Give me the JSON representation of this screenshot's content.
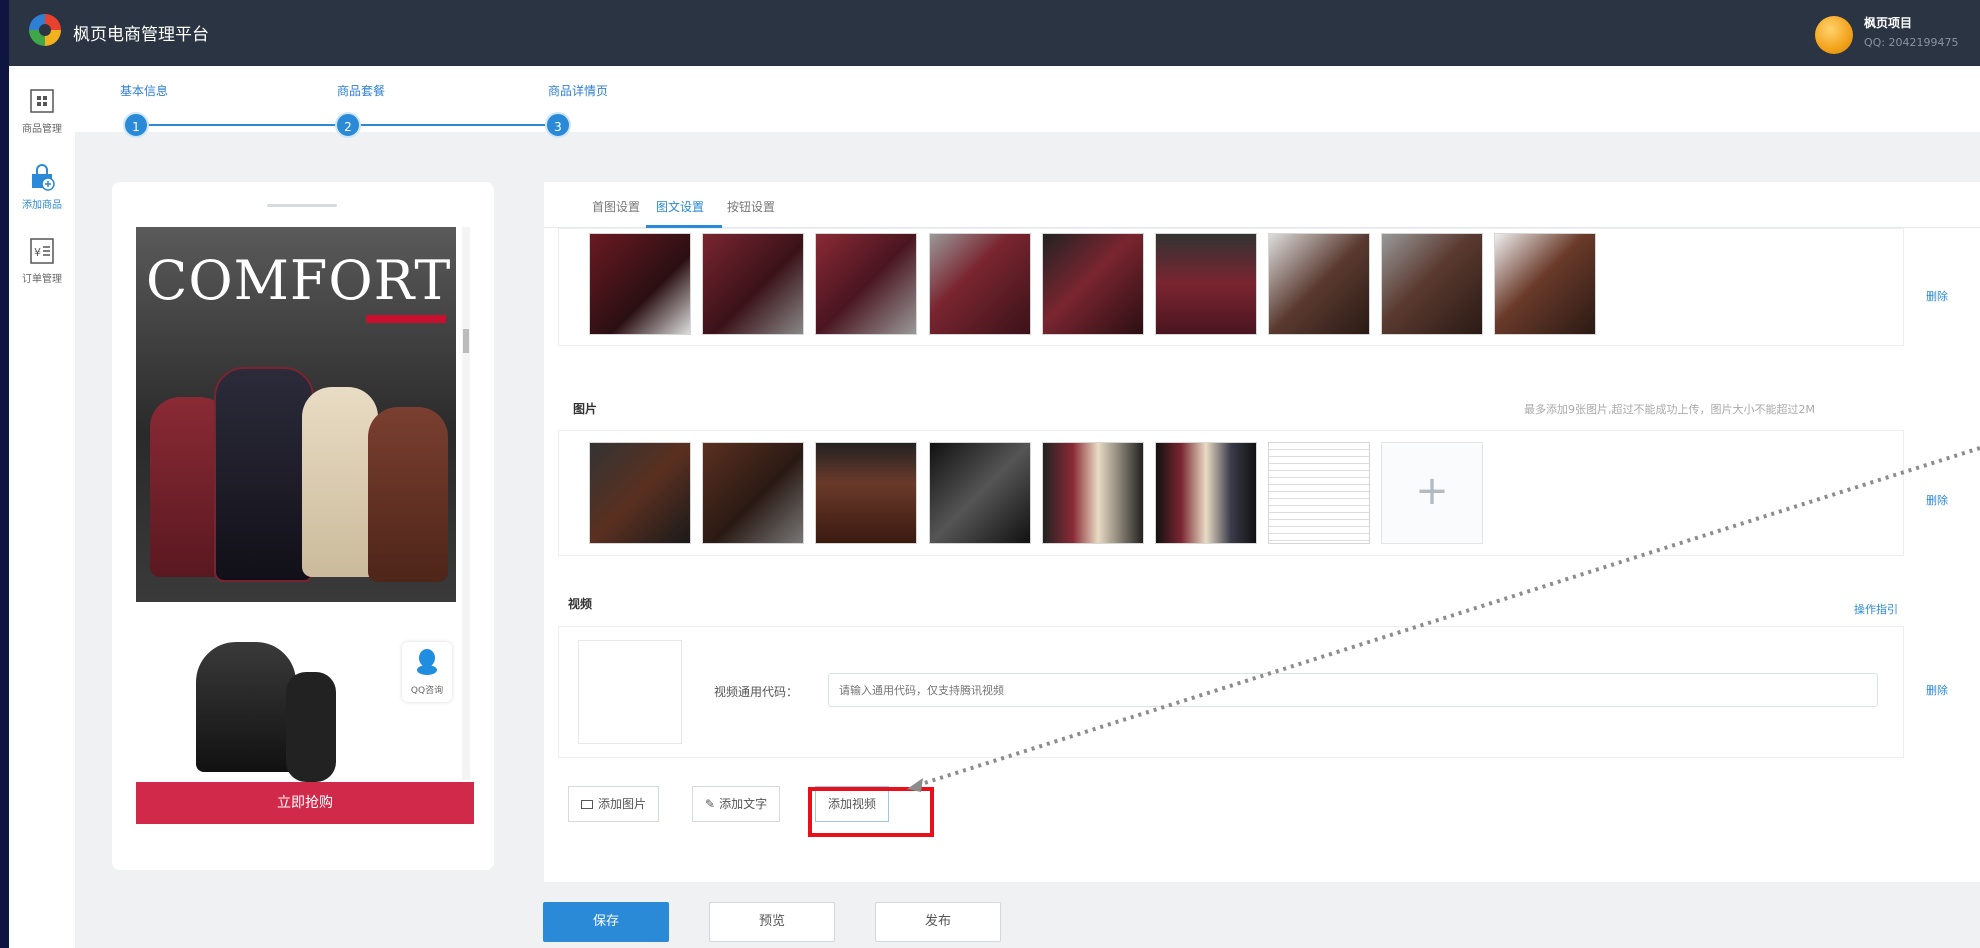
{
  "header": {
    "app_title": "枫页电商管理平台",
    "user_name": "枫页项目",
    "user_qq": "QQ: 2042199475"
  },
  "sidebar": {
    "items": [
      {
        "label": "商品管理",
        "icon": "product-grid-icon"
      },
      {
        "label": "添加商品",
        "icon": "add-bag-icon"
      },
      {
        "label": "订单管理",
        "icon": "order-yen-icon"
      }
    ]
  },
  "steps": [
    {
      "label": "基本信息",
      "number": "1"
    },
    {
      "label": "商品套餐",
      "number": "2"
    },
    {
      "label": "商品详情页",
      "number": "3"
    }
  ],
  "preview": {
    "banner_text": "COMFORT",
    "qq_label": "QQ咨询",
    "buy_button": "立即抢购"
  },
  "tabs": [
    {
      "label": "首图设置",
      "active": false
    },
    {
      "label": "图文设置",
      "active": true
    },
    {
      "label": "按钮设置",
      "active": false
    }
  ],
  "content": {
    "delete_label": "删除",
    "images_title": "图片",
    "images_hint": "最多添加9张图片,超过不能成功上传，图片大小不能超过2M",
    "add_plus": "+",
    "video_title": "视频",
    "video_guide": "操作指引",
    "video_code_label": "视频通用代码：",
    "video_input_placeholder": "请输入通用代码，仅支持腾讯视频"
  },
  "toolbar": {
    "add_image": "添加图片",
    "add_text": "添加文字",
    "add_video": "添加视频"
  },
  "footer": {
    "save": "保存",
    "preview": "预览",
    "publish": "发布"
  },
  "colors": {
    "accent": "#2a8ad8",
    "header_bg": "#2b3442",
    "buy_red": "#d1294a",
    "highlight_red": "#e8101a"
  }
}
